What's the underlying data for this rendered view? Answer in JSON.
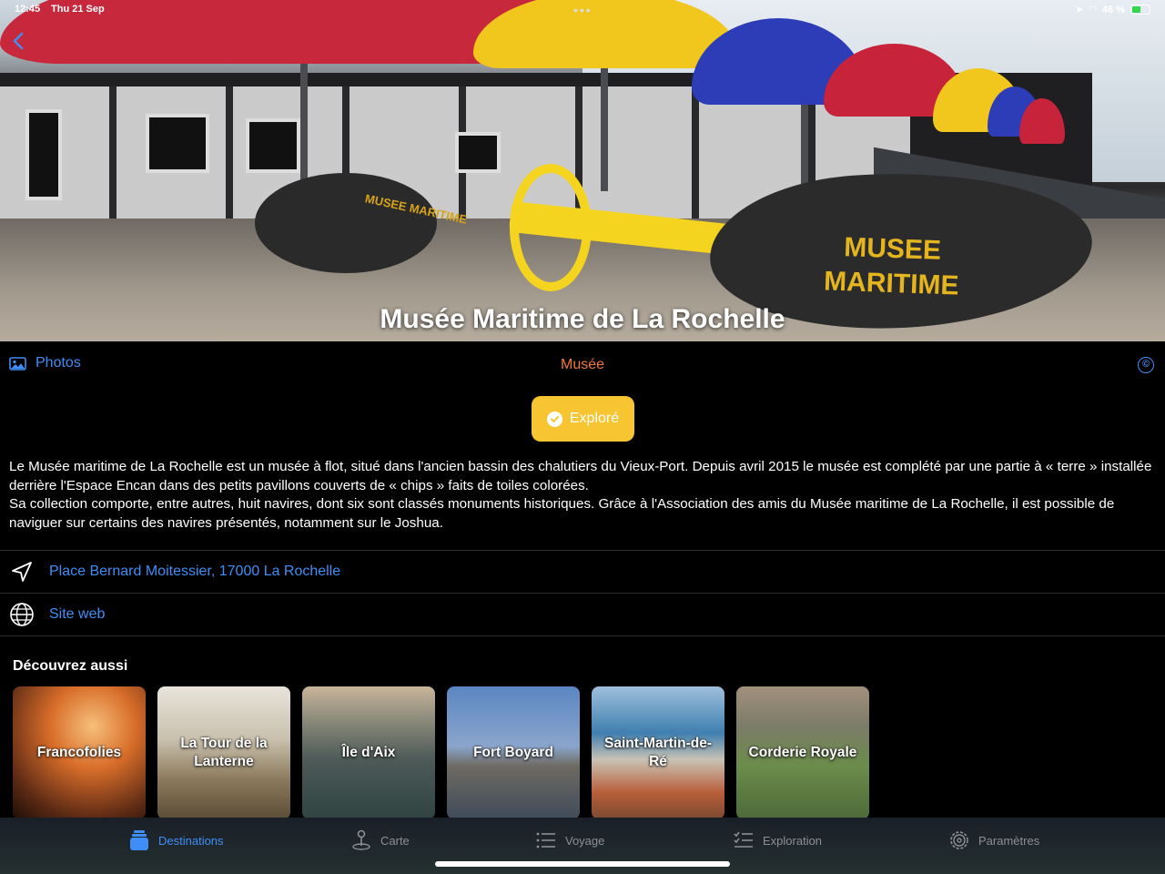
{
  "status_bar": {
    "time": "12:45",
    "date": "Thu 21 Sep",
    "battery": "46 %"
  },
  "hero": {
    "title": "Musée Maritime de La Rochelle",
    "buoy_text_large": "MUSEE MARITIME",
    "buoy_text_small": "MUSEE MARITIME"
  },
  "info": {
    "photos_label": "Photos",
    "category": "Musée",
    "copyright_symbol": "©",
    "category_color": "#f07a3a"
  },
  "explore_button": {
    "label": "Exploré",
    "color": "#f7c531"
  },
  "description": {
    "paragraph1": "Le Musée maritime de La Rochelle est un musée à flot, situé dans l'ancien bassin des chalutiers du Vieux-Port. Depuis avril 2015 le musée est complété par une partie à « terre » installée derrière l'Espace Encan dans des petits pavillons couverts de « chips » faits de toiles colorées.",
    "paragraph2": "Sa collection comporte, entre autres, huit navires, dont six sont classés monuments historiques. Grâce à l'Association des amis du Musée maritime de La Rochelle, il est possible de naviguer sur certains des navires présentés, notamment sur le Joshua."
  },
  "links": {
    "address": "Place Bernard Moitessier, 17000 La Rochelle",
    "website": "Site web"
  },
  "discover": {
    "title": "Découvrez aussi",
    "cards": [
      {
        "label": "Francofolies"
      },
      {
        "label": "La Tour de la Lanterne"
      },
      {
        "label": "Île d'Aix"
      },
      {
        "label": "Fort Boyard"
      },
      {
        "label": "Saint-Martin-de-Ré"
      },
      {
        "label": "Corderie Royale"
      }
    ]
  },
  "tabbar": {
    "tabs": [
      {
        "label": "Destinations",
        "icon": "destinations-icon",
        "active": true
      },
      {
        "label": "Carte",
        "icon": "map-pin-icon"
      },
      {
        "label": "Voyage",
        "icon": "list-icon"
      },
      {
        "label": "Exploration",
        "icon": "checklist-icon"
      },
      {
        "label": "Paramètres",
        "icon": "gear-icon"
      }
    ],
    "accent_color": "#3f8ef7"
  }
}
